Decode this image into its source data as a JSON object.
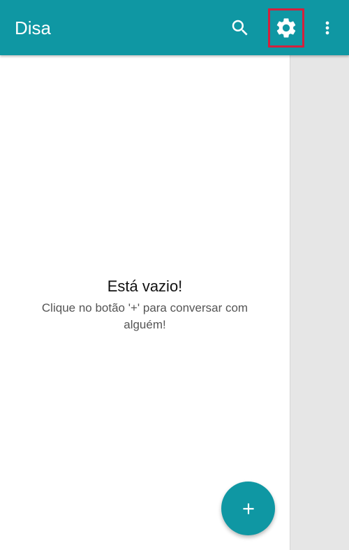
{
  "appbar": {
    "title": "Disa",
    "icons": {
      "search": "search-icon",
      "settings": "gear-icon",
      "more": "more-vert-icon"
    },
    "color": "#0f97a3",
    "highlight_color": "#d4213d"
  },
  "empty_state": {
    "title": "Está vazio!",
    "hint": "Clique no botão '+' para conversar com alguém!"
  },
  "fab": {
    "icon": "plus-icon",
    "label": "+"
  },
  "colors": {
    "background": "#ffffff",
    "side_panel": "#e6e6e6"
  }
}
